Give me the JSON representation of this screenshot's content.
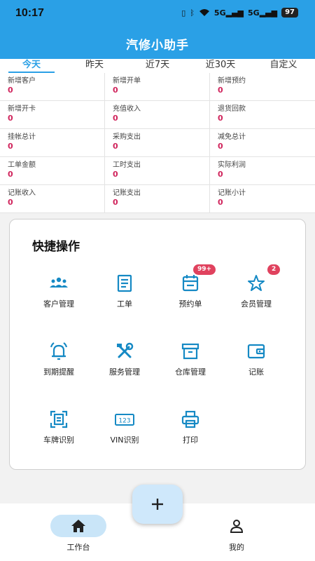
{
  "status_bar": {
    "time": "10:17",
    "battery": "97",
    "net1": "5G",
    "net2": "5G"
  },
  "header": {
    "title": "汽修小助手"
  },
  "tabs": [
    {
      "label": "今天",
      "active": true
    },
    {
      "label": "昨天",
      "active": false
    },
    {
      "label": "近7天",
      "active": false
    },
    {
      "label": "近30天",
      "active": false
    },
    {
      "label": "自定义",
      "active": false
    }
  ],
  "stats": [
    {
      "label": "新增客户",
      "value": "0"
    },
    {
      "label": "新增开单",
      "value": "0"
    },
    {
      "label": "新增预约",
      "value": "0"
    },
    {
      "label": "新增开卡",
      "value": "0"
    },
    {
      "label": "充值收入",
      "value": "0"
    },
    {
      "label": "退货回款",
      "value": "0"
    },
    {
      "label": "挂帐总计",
      "value": "0"
    },
    {
      "label": "采购支出",
      "value": "0"
    },
    {
      "label": "减免总计",
      "value": "0"
    },
    {
      "label": "工单金额",
      "value": "0"
    },
    {
      "label": "工时支出",
      "value": "0"
    },
    {
      "label": "实际利润",
      "value": "0"
    },
    {
      "label": "记账收入",
      "value": "0"
    },
    {
      "label": "记账支出",
      "value": "0"
    },
    {
      "label": "记账小计",
      "value": "0"
    }
  ],
  "quick_actions": {
    "title": "快捷操作",
    "items": [
      {
        "label": "客户管理",
        "icon": "customers-icon"
      },
      {
        "label": "工单",
        "icon": "work-order-icon"
      },
      {
        "label": "预约单",
        "icon": "calendar-icon",
        "badge": "99+"
      },
      {
        "label": "会员管理",
        "icon": "star-icon",
        "badge": "2"
      },
      {
        "label": "到期提醒",
        "icon": "bell-icon"
      },
      {
        "label": "服务管理",
        "icon": "tools-icon"
      },
      {
        "label": "仓库管理",
        "icon": "archive-icon"
      },
      {
        "label": "记账",
        "icon": "wallet-icon"
      },
      {
        "label": "车牌识别",
        "icon": "scan-plate-icon"
      },
      {
        "label": "VIN识别",
        "icon": "vin-icon",
        "icon_text": "123"
      },
      {
        "label": "打印",
        "icon": "printer-icon"
      }
    ]
  },
  "fab": {
    "symbol": "+"
  },
  "bottom_nav": [
    {
      "label": "工作台",
      "icon": "home-icon",
      "active": true
    },
    {
      "label": "我的",
      "icon": "person-icon",
      "active": false
    }
  ],
  "colors": {
    "primary": "#2aa0e6",
    "icon_teal": "#1589c4",
    "value_red": "#d0245c",
    "badge": "#e0425e"
  }
}
